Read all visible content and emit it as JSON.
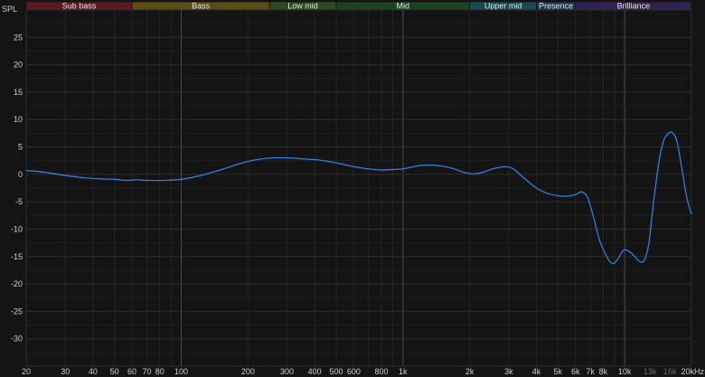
{
  "chart_data": {
    "type": "line",
    "ylabel": "SPL",
    "x_scale": "log",
    "xlim": [
      20,
      20000
    ],
    "ylim": [
      -35,
      30
    ],
    "grid": true,
    "y_ticks": [
      25,
      20,
      15,
      10,
      5,
      0,
      -5,
      -10,
      -15,
      -20,
      -25,
      -30
    ],
    "x_ticks": [
      {
        "value": 20,
        "label": "20"
      },
      {
        "value": 30,
        "label": "30"
      },
      {
        "value": 40,
        "label": "40"
      },
      {
        "value": 50,
        "label": "50"
      },
      {
        "value": 60,
        "label": "60"
      },
      {
        "value": 70,
        "label": "70"
      },
      {
        "value": 80,
        "label": "80"
      },
      {
        "value": 100,
        "label": "100"
      },
      {
        "value": 200,
        "label": "200"
      },
      {
        "value": 300,
        "label": "300"
      },
      {
        "value": 400,
        "label": "400"
      },
      {
        "value": 500,
        "label": "500"
      },
      {
        "value": 600,
        "label": "600"
      },
      {
        "value": 800,
        "label": "800"
      },
      {
        "value": 1000,
        "label": "1k"
      },
      {
        "value": 2000,
        "label": "2k"
      },
      {
        "value": 3000,
        "label": "3k"
      },
      {
        "value": 4000,
        "label": "4k"
      },
      {
        "value": 5000,
        "label": "5k"
      },
      {
        "value": 6000,
        "label": "6k"
      },
      {
        "value": 7000,
        "label": "7k"
      },
      {
        "value": 8000,
        "label": "8k"
      },
      {
        "value": 10000,
        "label": "10k"
      },
      {
        "value": 13000,
        "label": "13k",
        "dim": true
      },
      {
        "value": 16000,
        "label": "16k",
        "dim": true
      },
      {
        "value": 20000,
        "label": "20kHz"
      }
    ],
    "bands": [
      {
        "label": "Sub bass",
        "from": 20,
        "to": 60,
        "color": "#5b1a22"
      },
      {
        "label": "Bass",
        "from": 60,
        "to": 250,
        "color": "#5a4b18"
      },
      {
        "label": "Low mid",
        "from": 250,
        "to": 500,
        "color": "#2c4a1f"
      },
      {
        "label": "Mid",
        "from": 500,
        "to": 2000,
        "color": "#1c4424"
      },
      {
        "label": "Upper mid",
        "from": 2000,
        "to": 4000,
        "color": "#1b4a4e"
      },
      {
        "label": "Presence",
        "from": 4000,
        "to": 6000,
        "color": "#1f3352"
      },
      {
        "label": "Brilliance",
        "from": 6000,
        "to": 20000,
        "color": "#33224d"
      }
    ],
    "series": [
      {
        "color": "#2f7fe0",
        "points": [
          [
            20,
            0.7
          ],
          [
            24,
            0.4
          ],
          [
            30,
            -0.2
          ],
          [
            36,
            -0.6
          ],
          [
            42,
            -0.8
          ],
          [
            50,
            -0.9
          ],
          [
            56,
            -1.1
          ],
          [
            63,
            -1.0
          ],
          [
            70,
            -1.1
          ],
          [
            85,
            -1.1
          ],
          [
            100,
            -0.9
          ],
          [
            120,
            -0.3
          ],
          [
            150,
            0.8
          ],
          [
            185,
            2.0
          ],
          [
            220,
            2.7
          ],
          [
            260,
            3.0
          ],
          [
            300,
            3.0
          ],
          [
            360,
            2.8
          ],
          [
            420,
            2.6
          ],
          [
            500,
            2.1
          ],
          [
            600,
            1.4
          ],
          [
            700,
            1.0
          ],
          [
            800,
            0.8
          ],
          [
            920,
            0.9
          ],
          [
            1000,
            1.0
          ],
          [
            1150,
            1.5
          ],
          [
            1300,
            1.7
          ],
          [
            1500,
            1.5
          ],
          [
            1700,
            1.0
          ],
          [
            1900,
            0.3
          ],
          [
            2100,
            0.1
          ],
          [
            2300,
            0.4
          ],
          [
            2600,
            1.1
          ],
          [
            2900,
            1.4
          ],
          [
            3150,
            1.0
          ],
          [
            3500,
            -0.6
          ],
          [
            4000,
            -2.5
          ],
          [
            4500,
            -3.5
          ],
          [
            5000,
            -3.9
          ],
          [
            5500,
            -4.0
          ],
          [
            6000,
            -3.7
          ],
          [
            6400,
            -3.2
          ],
          [
            6800,
            -4.2
          ],
          [
            7200,
            -7.5
          ],
          [
            7700,
            -12.0
          ],
          [
            8300,
            -15.0
          ],
          [
            8800,
            -16.3
          ],
          [
            9300,
            -15.5
          ],
          [
            9800,
            -14.0
          ],
          [
            10200,
            -13.8
          ],
          [
            10800,
            -14.5
          ],
          [
            11600,
            -15.8
          ],
          [
            12200,
            -15.8
          ],
          [
            12800,
            -13.0
          ],
          [
            13500,
            -5.0
          ],
          [
            14300,
            2.5
          ],
          [
            15000,
            6.2
          ],
          [
            15800,
            7.5
          ],
          [
            16400,
            7.6
          ],
          [
            17200,
            6.0
          ],
          [
            18200,
            0.5
          ],
          [
            19000,
            -4.0
          ],
          [
            20000,
            -7.3
          ]
        ]
      }
    ]
  }
}
